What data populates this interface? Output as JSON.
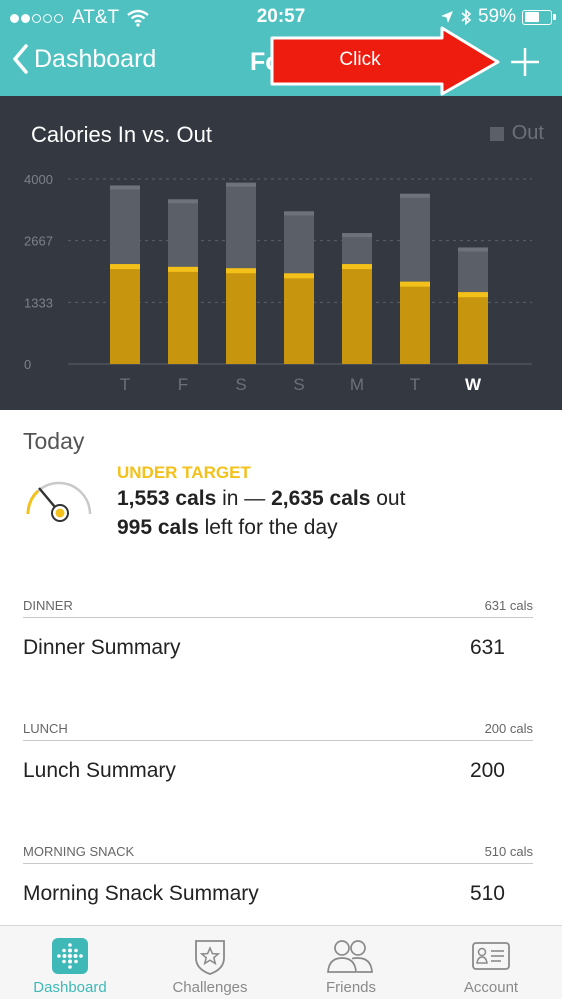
{
  "status_bar": {
    "carrier": "AT&T",
    "time": "20:57",
    "battery": "59%",
    "battery_level": 0.59
  },
  "nav": {
    "back_label": "Dashboard",
    "title_fragment": "Fc",
    "add_icon": "plus-icon"
  },
  "annotation": {
    "label": "Click",
    "color": "#ee1c0e"
  },
  "chart_data": {
    "type": "bar",
    "title": "Calories In vs. Out",
    "legend": [
      {
        "name": "Out",
        "color": "#5b6068"
      }
    ],
    "categories": [
      "T",
      "F",
      "S",
      "S",
      "M",
      "T",
      "W"
    ],
    "highlighted_category_index": 6,
    "y_ticks": [
      "4000",
      "2667",
      "1333",
      "0"
    ],
    "ylim": [
      0,
      4000
    ],
    "grid": true,
    "series": [
      {
        "name": "Out",
        "color": "#5b6068",
        "values": [
          3860,
          3560,
          3920,
          3300,
          2830,
          3680,
          2520
        ]
      },
      {
        "name": "In",
        "color": "#c8950e",
        "values": [
          2160,
          2100,
          2070,
          1960,
          2160,
          1780,
          1553
        ]
      }
    ]
  },
  "today": {
    "title": "Today",
    "status": "UNDER TARGET",
    "cals_in": "1,553 cals",
    "in_suffix": " in — ",
    "cals_out": "2,635 cals",
    "out_suffix": " out",
    "cals_left": "995 cals",
    "left_suffix": " left for the day"
  },
  "meals": [
    {
      "header": "DINNER",
      "header_cals": "631 cals",
      "label": "Dinner Summary",
      "value": "631"
    },
    {
      "header": "LUNCH",
      "header_cals": "200 cals",
      "label": "Lunch Summary",
      "value": "200"
    },
    {
      "header": "MORNING SNACK",
      "header_cals": "510 cals",
      "label": "Morning Snack Summary",
      "value": "510"
    }
  ],
  "tabs": [
    {
      "label": "Dashboard",
      "icon": "dashboard-icon",
      "active": true
    },
    {
      "label": "Challenges",
      "icon": "challenges-icon",
      "active": false
    },
    {
      "label": "Friends",
      "icon": "friends-icon",
      "active": false
    },
    {
      "label": "Account",
      "icon": "account-icon",
      "active": false
    }
  ],
  "colors": {
    "header": "#4fc1c1",
    "chart_bg": "#343941",
    "in_bar": "#c8950e",
    "in_bar_top": "#f3c11a",
    "accent_yellow": "#f3c11a",
    "tab_active": "#3fb8b8"
  }
}
